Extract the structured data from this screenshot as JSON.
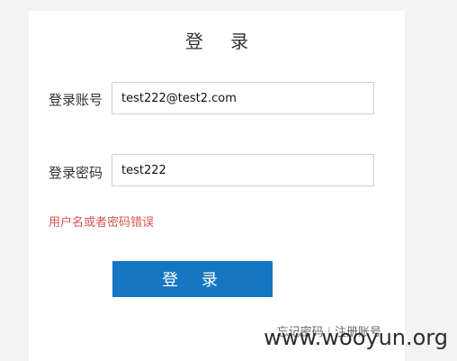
{
  "login": {
    "title": "登 录",
    "account_label": "登录账号",
    "account_value": "test222@test2.com",
    "password_label": "登录密码",
    "password_value": "test222",
    "error_message": "用户名或者密码错误",
    "submit_label": "登 录",
    "forgot_password_link": "忘记密码",
    "separator": "|",
    "register_link": "注册账号"
  },
  "watermark": {
    "text": "www.wooyun.org"
  }
}
